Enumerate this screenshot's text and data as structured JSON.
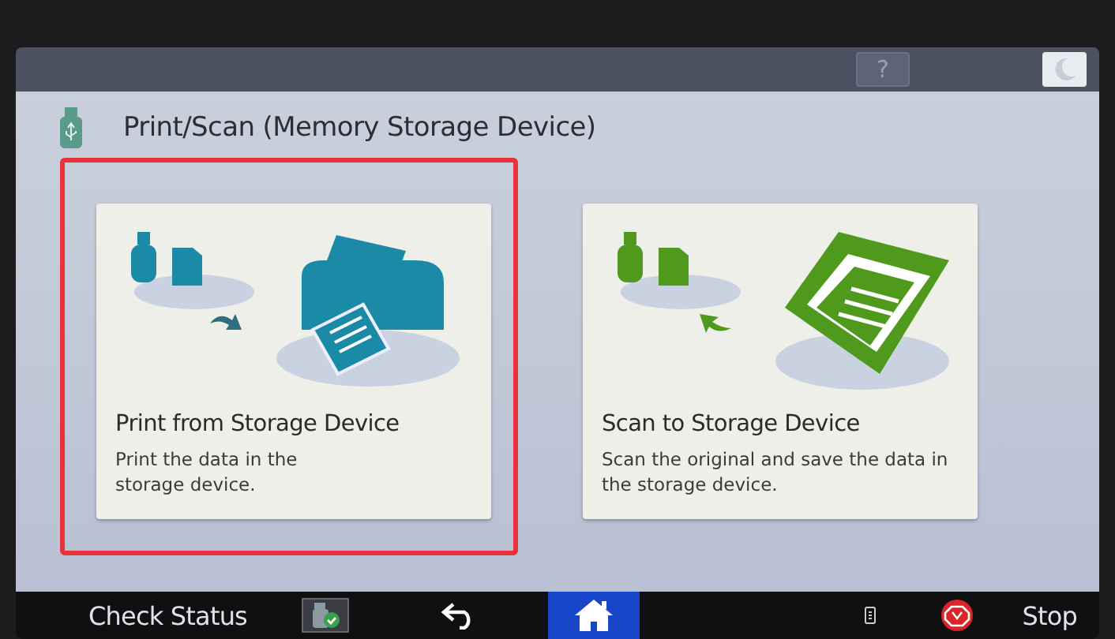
{
  "header": {
    "title": "Print/Scan (Memory Storage Device)"
  },
  "cards": [
    {
      "kind": "print",
      "title": "Print from Storage Device",
      "description": "Print the data in the storage device.",
      "selected": true,
      "color": "#1b8aa6"
    },
    {
      "kind": "scan",
      "title": "Scan to Storage Device",
      "description": "Scan the original and save the data in the storage device.",
      "selected": false,
      "color": "#4f9a1c"
    }
  ],
  "top_bar": {
    "help_label": "?"
  },
  "bottom_bar": {
    "left_label": "Check Status",
    "right_label": "Stop",
    "home_selected": true
  }
}
